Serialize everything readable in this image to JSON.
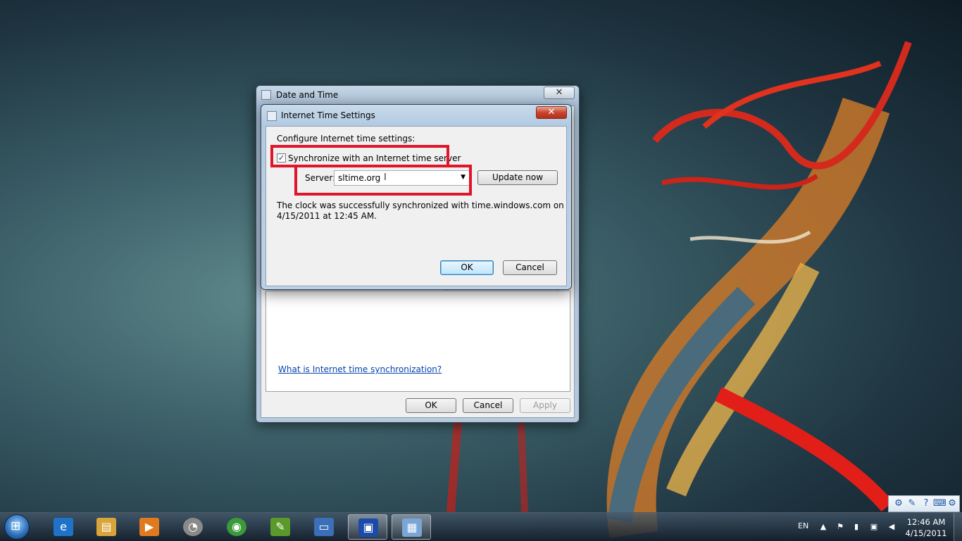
{
  "outer_window": {
    "title": "Date and Time",
    "close_glyph": "✕",
    "link_text": "What is Internet time synchronization?",
    "ok_label": "OK",
    "cancel_label": "Cancel",
    "apply_label": "Apply"
  },
  "inner_dialog": {
    "title": "Internet Time Settings",
    "close_glyph": "✕",
    "heading": "Configure Internet time settings:",
    "sync_checkbox_label": "Synchronize with an Internet time server",
    "sync_checked": true,
    "check_glyph": "✓",
    "server_label": "Server:",
    "server_value": "sltime.org",
    "update_now_label": "Update now",
    "status_line1": "The clock was successfully synchronized with time.windows.com on",
    "status_line2": "4/15/2011 at 12:45 AM.",
    "ok_label": "OK",
    "cancel_label": "Cancel"
  },
  "taskbar": {
    "pinned": [
      {
        "name": "internet-explorer",
        "glyph": "e",
        "color": "#1e73c8"
      },
      {
        "name": "windows-explorer",
        "glyph": "▤",
        "color": "#d9a53a"
      },
      {
        "name": "media-player",
        "glyph": "▶",
        "color": "#e07a1f"
      },
      {
        "name": "system-monitor",
        "glyph": "◔",
        "color": "#8a8a8a"
      },
      {
        "name": "chrome",
        "glyph": "◉",
        "color": "#3a9a3a"
      },
      {
        "name": "notepad-app",
        "glyph": "✎",
        "color": "#5a9a2a"
      },
      {
        "name": "window-app",
        "glyph": "▭",
        "color": "#3b6fb8"
      },
      {
        "name": "remote-app",
        "glyph": "▣",
        "color": "#1c4aa8"
      },
      {
        "name": "date-time-control-panel",
        "glyph": "▦",
        "color": "#7aa6d6"
      }
    ],
    "language": "EN",
    "clock_time": "12:46 AM",
    "clock_date": "4/15/2011"
  }
}
